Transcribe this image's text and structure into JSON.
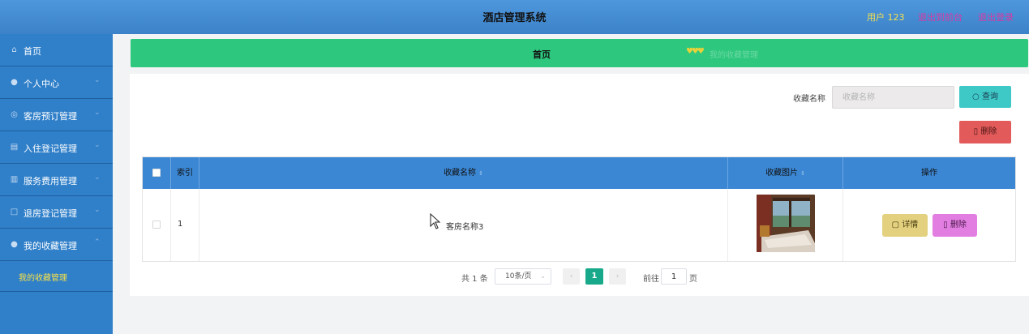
{
  "header": {
    "title": "酒店管理系统",
    "user": "用户 123",
    "exit_front": "退出到前台",
    "logout": "退出登录"
  },
  "sidebar": {
    "items": [
      {
        "label": "首页",
        "icon": "home-icon"
      },
      {
        "label": "个人中心",
        "icon": "user-icon"
      },
      {
        "label": "客房预订管理",
        "icon": "globe-icon"
      },
      {
        "label": "入住登记管理",
        "icon": "document-icon"
      },
      {
        "label": "服务费用管理",
        "icon": "bar-chart-icon"
      },
      {
        "label": "退房登记管理",
        "icon": "square-icon"
      },
      {
        "label": "我的收藏管理",
        "icon": "user-icon"
      }
    ],
    "active_sub": "我的收藏管理"
  },
  "breadcrumb": {
    "home": "首页",
    "current": "我的收藏管理"
  },
  "search": {
    "label": "收藏名称",
    "placeholder": "收藏名称",
    "query_btn": "查询",
    "delete_btn": "删除"
  },
  "table": {
    "columns": {
      "index": "索引",
      "name": "收藏名称",
      "image": "收藏图片",
      "actions": "操作"
    },
    "rows": [
      {
        "index": "1",
        "name": "客房名称3",
        "detail": "详情",
        "delete": "删除"
      }
    ]
  },
  "pager": {
    "total": "共 1 条",
    "page_size": "10条/页",
    "current": "1",
    "goto": "前往",
    "page_value": "1",
    "page_suffix": "页"
  },
  "colors": {
    "header": "#3b82c9",
    "sidebar": "#2f7fc9",
    "breadcrumb": "#2dc77d",
    "query": "#3ec9c7",
    "danger": "#e25a5a",
    "detail": "#e3d17f",
    "row_delete": "#e27ee1"
  }
}
